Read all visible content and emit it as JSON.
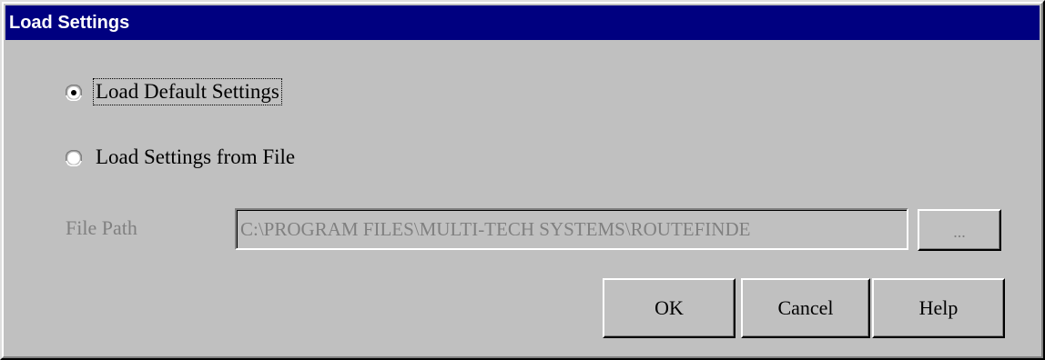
{
  "window": {
    "title": "Load Settings"
  },
  "options": {
    "default_label": "Load Default Settings",
    "default_selected": true,
    "file_label": "Load Settings from File",
    "file_selected": false
  },
  "file_path": {
    "label": "File Path",
    "value": "C:\\PROGRAM FILES\\MULTI-TECH SYSTEMS\\ROUTEFINDE",
    "enabled": false,
    "browse_label": "..."
  },
  "buttons": {
    "ok_label": "OK",
    "cancel_label": "Cancel",
    "help_label": "Help"
  },
  "colors": {
    "titlebar": "#000080",
    "face": "#c0c0c0",
    "disabled_text": "#808080"
  }
}
